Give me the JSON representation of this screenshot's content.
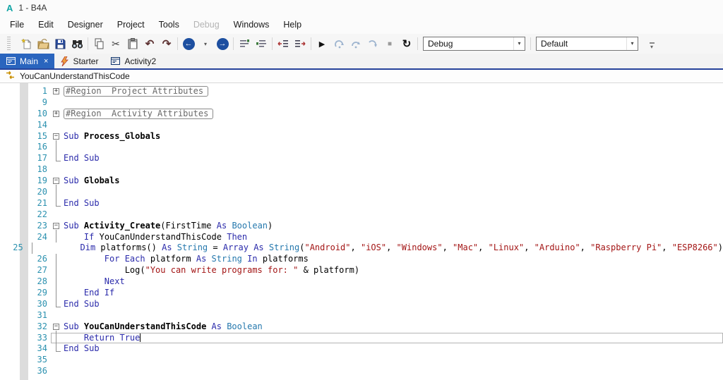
{
  "window": {
    "logo": "A",
    "title": "1 - B4A"
  },
  "colors": {
    "accent": "#2a65be",
    "accent_dark": "#27439b",
    "teal": "#12a5a5",
    "keyword": "#2b2bab",
    "type": "#2578ad",
    "string": "#a31515",
    "line_number": "#2b91af",
    "region": "#696969"
  },
  "menu": {
    "items": [
      {
        "label": "File"
      },
      {
        "label": "Edit"
      },
      {
        "label": "Designer"
      },
      {
        "label": "Project"
      },
      {
        "label": "Tools"
      },
      {
        "label": "Debug",
        "disabled": true
      },
      {
        "label": "Windows"
      },
      {
        "label": "Help"
      }
    ]
  },
  "toolbar": {
    "build_mode": "Debug",
    "build_config": "Default",
    "items": [
      {
        "icon": "handle",
        "name": "toolbar-drag-handle",
        "inter": false
      },
      {
        "icon": "new",
        "name": "new-project-button"
      },
      {
        "icon": "open",
        "name": "open-project-button"
      },
      {
        "icon": "save",
        "name": "save-button"
      },
      {
        "icon": "find",
        "name": "find-button"
      },
      {
        "sep": true
      },
      {
        "icon": "copy",
        "name": "copy-button"
      },
      {
        "icon": "cut",
        "name": "cut-button"
      },
      {
        "icon": "paste",
        "name": "paste-button"
      },
      {
        "icon": "undo",
        "name": "undo-button"
      },
      {
        "icon": "redo",
        "name": "redo-button"
      },
      {
        "sep": true
      },
      {
        "icon": "back",
        "name": "navigate-back-button"
      },
      {
        "icon": "caret",
        "name": "navigate-back-dropdown"
      },
      {
        "icon": "fwd",
        "name": "navigate-forward-button"
      },
      {
        "sep": true
      },
      {
        "icon": "comment",
        "name": "comment-button"
      },
      {
        "icon": "uncomment",
        "name": "uncomment-button"
      },
      {
        "sep": true
      },
      {
        "icon": "outdent",
        "name": "outdent-button"
      },
      {
        "icon": "indent",
        "name": "indent-button"
      },
      {
        "sep": true
      },
      {
        "icon": "run",
        "name": "run-button"
      },
      {
        "icon": "resume",
        "name": "resume-button"
      },
      {
        "icon": "stepover",
        "name": "step-over-button"
      },
      {
        "icon": "stepinto",
        "name": "step-into-button"
      },
      {
        "icon": "stop",
        "name": "stop-button"
      },
      {
        "icon": "rebuild",
        "name": "rebuild-button"
      },
      {
        "sep": true
      },
      {
        "combo": "build_mode",
        "name": "build-mode-select"
      },
      {
        "sep": true
      },
      {
        "combo": "build_config",
        "name": "build-configuration-select"
      },
      {
        "icon": "overflow",
        "name": "toolbar-overflow-button"
      }
    ]
  },
  "tabs": [
    {
      "label": "Main",
      "icon": "form",
      "active": true,
      "close": "×"
    },
    {
      "label": "Starter",
      "icon": "bolt"
    },
    {
      "label": "Activity2",
      "icon": "form"
    }
  ],
  "navbar": {
    "current_member": "YouCanUnderstandThisCode"
  },
  "editor": {
    "lines": [
      {
        "n": 1,
        "fold": "plus",
        "box": true,
        "seg": [
          [
            "region",
            "#Region  Project Attributes"
          ]
        ]
      },
      {
        "n": 9
      },
      {
        "n": 10,
        "fold": "plus",
        "box": true,
        "seg": [
          [
            "region",
            "#Region  Activity Attributes"
          ]
        ]
      },
      {
        "n": 14
      },
      {
        "n": 15,
        "fold": "minus",
        "seg": [
          [
            "kw",
            "Sub "
          ],
          [
            "name",
            "Process_Globals"
          ]
        ]
      },
      {
        "n": 16,
        "fold": "line"
      },
      {
        "n": 17,
        "fold": "end",
        "seg": [
          [
            "kw",
            "End Sub"
          ]
        ]
      },
      {
        "n": 18
      },
      {
        "n": 19,
        "fold": "minus",
        "seg": [
          [
            "kw",
            "Sub "
          ],
          [
            "name",
            "Globals"
          ]
        ]
      },
      {
        "n": 20,
        "fold": "line"
      },
      {
        "n": 21,
        "fold": "end",
        "seg": [
          [
            "kw",
            "End Sub"
          ]
        ]
      },
      {
        "n": 22
      },
      {
        "n": 23,
        "fold": "minus",
        "seg": [
          [
            "kw",
            "Sub "
          ],
          [
            "name",
            "Activity_Create"
          ],
          [
            "pln",
            "(FirstTime "
          ],
          [
            "kw",
            "As "
          ],
          [
            "typ",
            "Boolean"
          ],
          [
            "pln",
            ")"
          ]
        ]
      },
      {
        "n": 24,
        "fold": "line",
        "seg": [
          [
            "pln",
            "    "
          ],
          [
            "kw",
            "If "
          ],
          [
            "pln",
            "YouCanUnderstandThisCode "
          ],
          [
            "kw",
            "Then"
          ]
        ]
      },
      {
        "n": 25,
        "fold": "line",
        "seg": [
          [
            "pln",
            "        "
          ],
          [
            "kw",
            "Dim "
          ],
          [
            "pln",
            "platforms() "
          ],
          [
            "kw",
            "As "
          ],
          [
            "typ",
            "String"
          ],
          [
            "pln",
            " = "
          ],
          [
            "kw",
            "Array "
          ],
          [
            "kw",
            "As "
          ],
          [
            "typ",
            "String"
          ],
          [
            "pln",
            "("
          ],
          [
            "str",
            "\"Android\""
          ],
          [
            "pln",
            ", "
          ],
          [
            "str",
            "\"iOS\""
          ],
          [
            "pln",
            ", "
          ],
          [
            "str",
            "\"Windows\""
          ],
          [
            "pln",
            ", "
          ],
          [
            "str",
            "\"Mac\""
          ],
          [
            "pln",
            ", "
          ],
          [
            "str",
            "\"Linux\""
          ],
          [
            "pln",
            ", "
          ],
          [
            "str",
            "\"Arduino\""
          ],
          [
            "pln",
            ", "
          ],
          [
            "str",
            "\"Raspberry Pi\""
          ],
          [
            "pln",
            ", "
          ],
          [
            "str",
            "\"ESP8266\""
          ],
          [
            "pln",
            ")"
          ]
        ]
      },
      {
        "n": 26,
        "fold": "line",
        "seg": [
          [
            "pln",
            "        "
          ],
          [
            "kw",
            "For Each "
          ],
          [
            "pln",
            "platform "
          ],
          [
            "kw",
            "As "
          ],
          [
            "typ",
            "String"
          ],
          [
            "pln",
            " "
          ],
          [
            "kw",
            "In "
          ],
          [
            "pln",
            "platforms"
          ]
        ]
      },
      {
        "n": 27,
        "fold": "line",
        "seg": [
          [
            "pln",
            "            "
          ],
          [
            "pln",
            "Log("
          ],
          [
            "str",
            "\"You can write programs for: \""
          ],
          [
            "pln",
            " & platform)"
          ]
        ]
      },
      {
        "n": 28,
        "fold": "line",
        "seg": [
          [
            "pln",
            "        "
          ],
          [
            "kw",
            "Next"
          ]
        ]
      },
      {
        "n": 29,
        "fold": "line",
        "seg": [
          [
            "pln",
            "    "
          ],
          [
            "kw",
            "End If"
          ]
        ]
      },
      {
        "n": 30,
        "fold": "end",
        "seg": [
          [
            "kw",
            "End Sub"
          ]
        ]
      },
      {
        "n": 31
      },
      {
        "n": 32,
        "fold": "minus",
        "seg": [
          [
            "kw",
            "Sub "
          ],
          [
            "name",
            "YouCanUnderstandThisCode"
          ],
          [
            "kw",
            " As "
          ],
          [
            "typ",
            "Boolean"
          ]
        ]
      },
      {
        "n": 33,
        "fold": "line",
        "current": true,
        "cursor": true,
        "seg": [
          [
            "pln",
            "    "
          ],
          [
            "kw",
            "Return True"
          ]
        ]
      },
      {
        "n": 34,
        "fold": "end",
        "seg": [
          [
            "kw",
            "End Sub"
          ]
        ]
      },
      {
        "n": 35
      },
      {
        "n": 36
      }
    ]
  }
}
